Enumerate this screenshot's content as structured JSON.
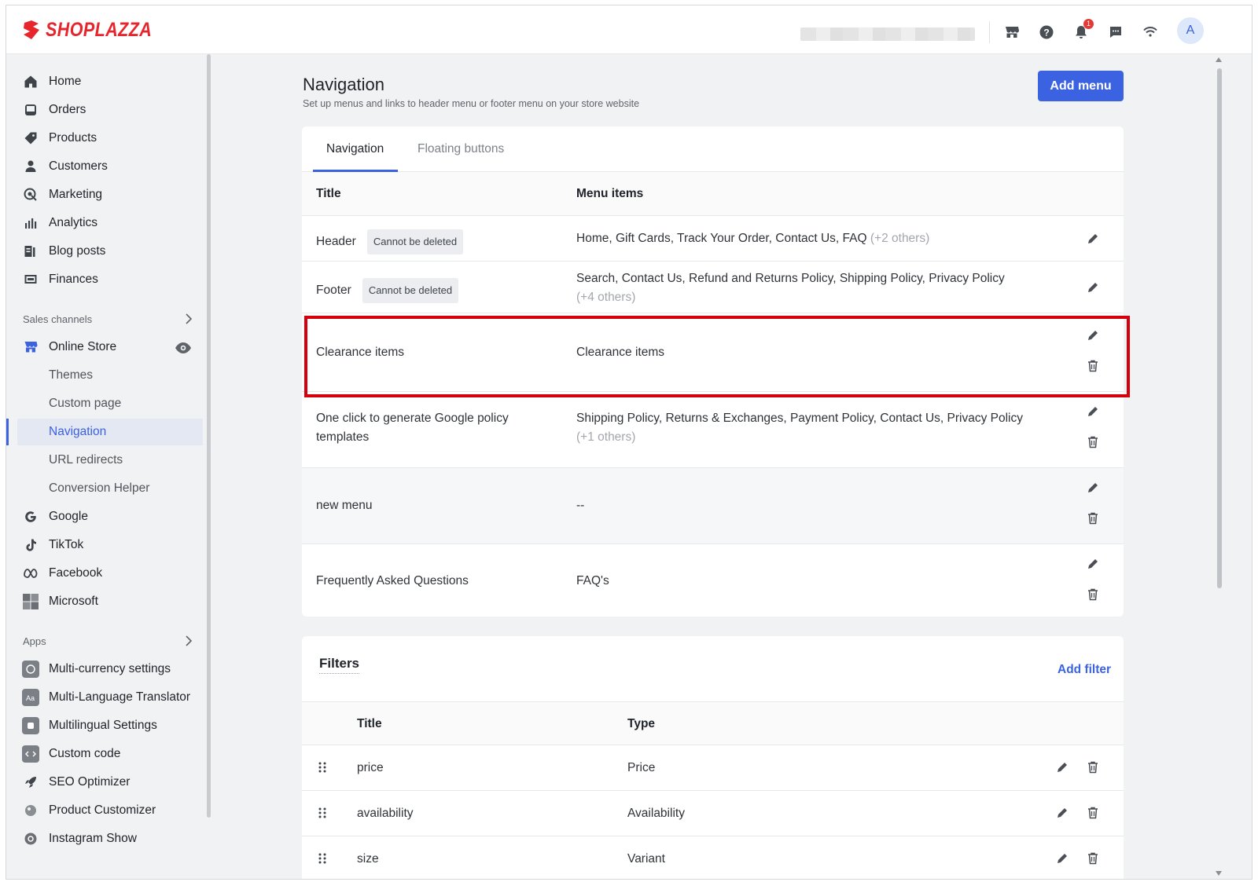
{
  "brand": {
    "name": "SHOPLAZZA",
    "color": "#e6262c"
  },
  "topbar": {
    "notifications_count": "1",
    "avatar_letter": "A",
    "icons": [
      "store-icon",
      "help-icon",
      "bell-icon",
      "chat-icon",
      "wifi-icon"
    ]
  },
  "sidebar": {
    "items": [
      {
        "label": "Home",
        "icon": "home-icon"
      },
      {
        "label": "Orders",
        "icon": "orders-icon"
      },
      {
        "label": "Products",
        "icon": "tag-icon"
      },
      {
        "label": "Customers",
        "icon": "person-icon"
      },
      {
        "label": "Marketing",
        "icon": "marketing-icon"
      },
      {
        "label": "Analytics",
        "icon": "bar-chart-icon"
      },
      {
        "label": "Blog posts",
        "icon": "blog-icon"
      },
      {
        "label": "Finances",
        "icon": "finance-icon"
      }
    ],
    "sales_channels_label": "Sales channels",
    "online_store": "Online Store",
    "online_store_sub": [
      {
        "label": "Themes"
      },
      {
        "label": "Custom page"
      },
      {
        "label": "Navigation",
        "active": true
      },
      {
        "label": "URL redirects"
      },
      {
        "label": "Conversion Helper"
      }
    ],
    "channels": [
      {
        "label": "Google",
        "icon": "google-icon"
      },
      {
        "label": "TikTok",
        "icon": "tiktok-icon"
      },
      {
        "label": "Facebook",
        "icon": "meta-icon"
      },
      {
        "label": "Microsoft",
        "icon": "microsoft-icon"
      }
    ],
    "apps_label": "Apps",
    "apps": [
      {
        "label": "Multi-currency settings",
        "icon": "currency-app-icon"
      },
      {
        "label": "Multi-Language Translator",
        "icon": "translator-app-icon"
      },
      {
        "label": "Multilingual Settings",
        "icon": "multilingual-app-icon"
      },
      {
        "label": "Custom code",
        "icon": "code-app-icon"
      },
      {
        "label": "SEO Optimizer",
        "icon": "rocket-icon"
      },
      {
        "label": "Product Customizer",
        "icon": "customizer-app-icon"
      },
      {
        "label": "Instagram Show",
        "icon": "instagram-icon"
      }
    ]
  },
  "page": {
    "title": "Navigation",
    "subtitle": "Set up menus and links to header menu or footer menu on your store website",
    "add_menu_label": "Add menu",
    "accent": "#3b62e0"
  },
  "tabs": [
    {
      "label": "Navigation",
      "active": true
    },
    {
      "label": "Floating buttons",
      "active": false
    }
  ],
  "menu_table": {
    "headers": {
      "title": "Title",
      "items": "Menu items"
    },
    "rows": [
      {
        "title": "Header",
        "tag": "Cannot be deleted",
        "items": "Home, Gift Cards, Track Your Order, Contact Us, FAQ",
        "more": "(+2 others)"
      },
      {
        "title": "Footer",
        "tag": "Cannot be deleted",
        "items": "Search, Contact Us, Refund and Returns Policy, Shipping Policy, Privacy Policy",
        "more": "(+4 others)"
      },
      {
        "title": "Clearance items",
        "items": "Clearance items",
        "more": ""
      },
      {
        "title": "One click to generate Google policy templates",
        "items": "Shipping Policy, Returns & Exchanges, Payment Policy, Contact Us, Privacy Policy",
        "more": "(+1 others)"
      },
      {
        "title": "new menu",
        "items": "--",
        "more": ""
      },
      {
        "title": "Frequently Asked Questions",
        "items": "FAQ's",
        "more": ""
      }
    ]
  },
  "filters": {
    "title": "Filters",
    "add_label": "Add filter",
    "headers": {
      "title": "Title",
      "type": "Type"
    },
    "rows": [
      {
        "title": "price",
        "type": "Price"
      },
      {
        "title": "availability",
        "type": "Availability"
      },
      {
        "title": "size",
        "type": "Variant"
      }
    ]
  }
}
